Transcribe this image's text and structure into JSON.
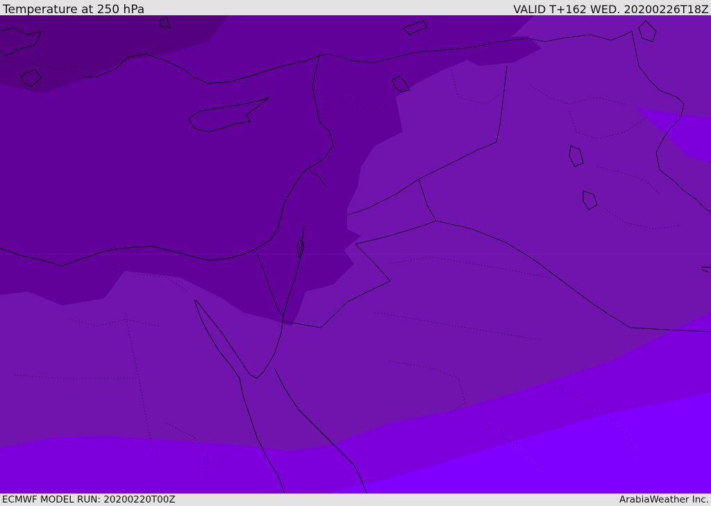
{
  "header": {
    "title": "Temperature at 250 hPa",
    "valid": "VALID T+162 WED. 20200226T18Z"
  },
  "footer": {
    "model_run": "ECMWF MODEL RUN: 20200220T00Z",
    "credit": "ArabiaWeather Inc."
  },
  "map": {
    "region": "Eastern Mediterranean and Middle East",
    "field": "temperature",
    "level": "250 hPa",
    "colors": {
      "band_darkest": "#54007f",
      "band_dark": "#62009a",
      "band_mid": "#7014ad",
      "band_violet": "#7d00dc",
      "band_bright": "#8000ff",
      "coastline": "#000000",
      "border": "#000000",
      "header_bg": "#e3e3e3",
      "text": "#111111"
    }
  }
}
